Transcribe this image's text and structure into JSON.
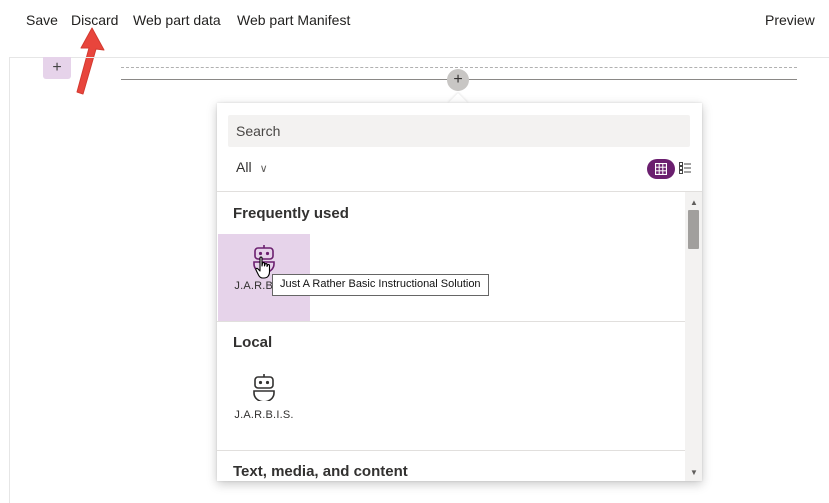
{
  "toolbar": {
    "save": "Save",
    "discard": "Discard",
    "web_part_data": "Web part data",
    "web_part_manifest": "Web part Manifest",
    "preview": "Preview"
  },
  "canvas": {
    "section_add_glyph": "+",
    "add_webpart_glyph": "+"
  },
  "picker": {
    "search_placeholder": "Search",
    "filter_value": "All",
    "filter_chevron": "∨",
    "categories": [
      {
        "title": "Frequently used",
        "items": [
          {
            "label": "J.A.R.B.I.S.",
            "hovered": true,
            "icon": "robot-icon"
          }
        ]
      },
      {
        "title": "Local",
        "items": [
          {
            "label": "J.A.R.B.I.S.",
            "hovered": false,
            "icon": "robot-icon"
          }
        ]
      },
      {
        "title": "Text, media, and content",
        "items": []
      }
    ],
    "tooltip": "Just A Rather Basic Instructional Solution"
  },
  "colors": {
    "accent": "#6b1f6f",
    "hover": "#e6d3ea",
    "annotation_arrow": "#e8453c"
  }
}
